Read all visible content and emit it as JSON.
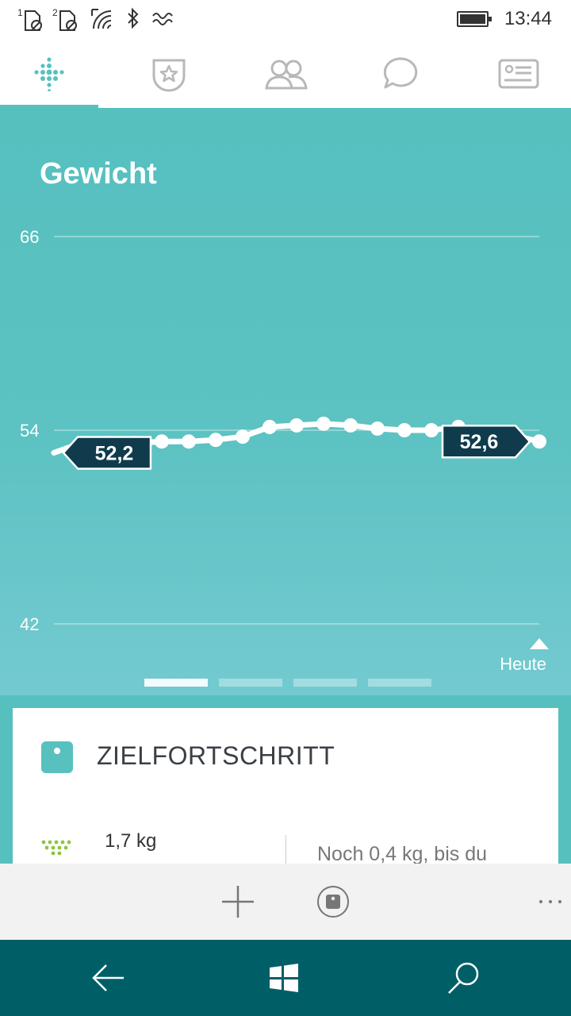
{
  "status_bar": {
    "sim1_label": "1",
    "sim2_label": "2",
    "time": "13:44",
    "icons": [
      "sim1-blocked-icon",
      "sim2-blocked-icon",
      "wifi-icon",
      "bluetooth-icon",
      "vibrate-icon",
      "battery-icon"
    ]
  },
  "tabs": [
    {
      "name": "dashboard",
      "icon": "fitbit-dots-icon",
      "active": true
    },
    {
      "name": "challenges",
      "icon": "badge-star-icon",
      "active": false
    },
    {
      "name": "friends",
      "icon": "friends-icon",
      "active": false
    },
    {
      "name": "messages",
      "icon": "chat-bubble-icon",
      "active": false
    },
    {
      "name": "account",
      "icon": "profile-card-icon",
      "active": false
    }
  ],
  "colors": {
    "accent": "#58c1bf",
    "badge_bg": "#0f3b4d",
    "nav_bg": "#005f66",
    "trend_green": "#8cc63f"
  },
  "chart_data": {
    "type": "line",
    "title": "Gewicht",
    "y_ticks": [
      "66",
      "54",
      "42"
    ],
    "ylim": [
      42,
      66
    ],
    "x_end_label": "Heute",
    "series": [
      {
        "values": [
          52.6,
          53.2,
          53.2,
          53.2,
          53.3,
          53.3,
          53.4,
          53.6,
          54.2,
          54.3,
          54.4,
          54.3,
          54.1,
          54.0,
          54.0,
          54.2,
          53.9,
          53.7,
          53.3
        ]
      }
    ],
    "start_label": "52,2",
    "end_label": "52,6",
    "pages": 4,
    "active_page": 1
  },
  "card": {
    "icon": "scale-icon",
    "title": "ZIELFORTSCHRITT",
    "trend_icon": "trend-down-dots-icon",
    "value": "1,7 kg",
    "note": "Noch 0,4 kg, bis du"
  },
  "app_bar": {
    "icons": [
      "add-icon",
      "scale-log-icon",
      "more-icon"
    ]
  },
  "nav_bar": {
    "icons": [
      "back-arrow-icon",
      "windows-start-icon",
      "search-icon"
    ]
  }
}
